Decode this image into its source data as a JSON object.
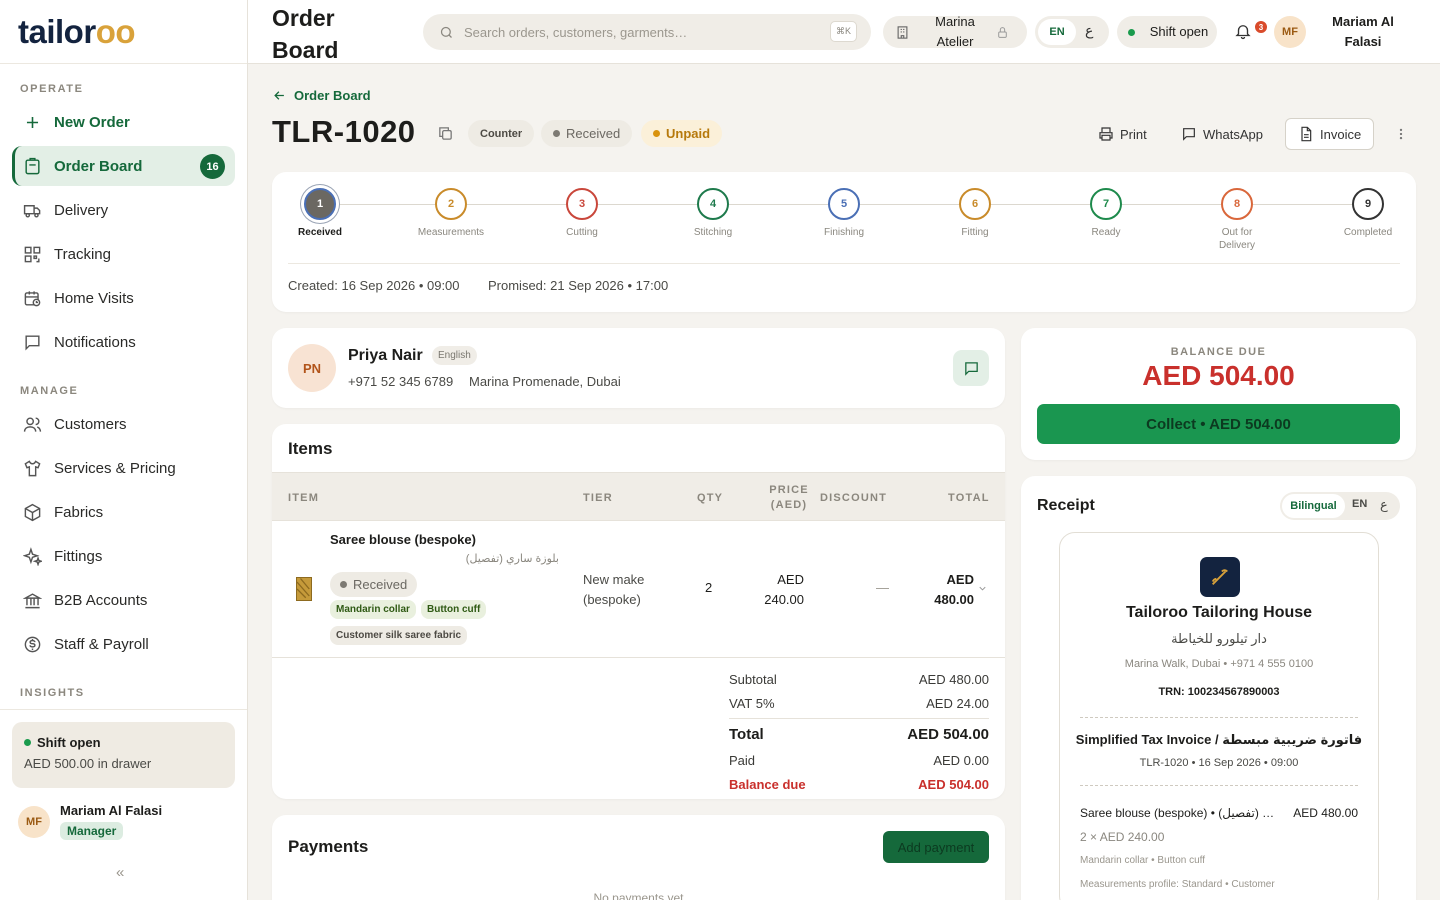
{
  "brand": {
    "logo_main": "tailor",
    "logo_accent": "oo"
  },
  "sidebar": {
    "section_operate": "OPERATE",
    "section_manage": "MANAGE",
    "section_insights": "INSIGHTS",
    "new_order": "New Order",
    "items": [
      {
        "label": "Order Board",
        "badge": "16"
      },
      {
        "label": "Delivery"
      },
      {
        "label": "Tracking"
      },
      {
        "label": "Home Visits"
      },
      {
        "label": "Notifications"
      },
      {
        "label": "Customers"
      },
      {
        "label": "Services & Pricing"
      },
      {
        "label": "Fabrics"
      },
      {
        "label": "Fittings"
      },
      {
        "label": "B2B Accounts"
      },
      {
        "label": "Staff & Payroll"
      }
    ],
    "shift": {
      "title": "Shift open",
      "drawer": "AED 500.00 in drawer"
    },
    "user": {
      "initials": "MF",
      "name": "Mariam Al Falasi",
      "role": "Manager"
    },
    "collapse": "«"
  },
  "topbar": {
    "title": "Order Board",
    "search_placeholder": "Search orders, customers, garments…",
    "shortcut": "⌘K",
    "branch": "Marina Atelier",
    "lang_en": "EN",
    "lang_ar": "ع",
    "shift": "Shift open",
    "notif_count": "3",
    "user_initials": "MF",
    "user_name": "Mariam Al Falasi"
  },
  "order": {
    "back": "Order Board",
    "id": "TLR-1020",
    "channel": "Counter",
    "status": "Received",
    "payment": "Unpaid",
    "actions": {
      "print": "Print",
      "whatsapp": "WhatsApp",
      "invoice": "Invoice"
    },
    "steps": [
      {
        "n": "1",
        "label": "Received",
        "color": "#4a6fb5"
      },
      {
        "n": "2",
        "label": "Measurements",
        "color": "#c98b2a"
      },
      {
        "n": "3",
        "label": "Cutting",
        "color": "#c9473b"
      },
      {
        "n": "4",
        "label": "Stitching",
        "color": "#1e7a4c"
      },
      {
        "n": "5",
        "label": "Finishing",
        "color": "#4a6fb5"
      },
      {
        "n": "6",
        "label": "Fitting",
        "color": "#c98b2a"
      },
      {
        "n": "7",
        "label": "Ready",
        "color": "#1e8a4c"
      },
      {
        "n": "8",
        "label": "Out for Delivery",
        "color": "#d9673b"
      },
      {
        "n": "9",
        "label": "Completed",
        "color": "#333333"
      }
    ],
    "created": "Created: 16 Sep 2026 • 09:00",
    "promised": "Promised: 21 Sep 2026 • 17:00"
  },
  "customer": {
    "initials": "PN",
    "name": "Priya Nair",
    "language": "English",
    "phone": "+971 52 345 6789",
    "address": "Marina Promenade, Dubai"
  },
  "items": {
    "title": "Items",
    "headers": {
      "item": "ITEM",
      "tier": "TIER",
      "qty": "QTY",
      "price": "PRICE (AED)",
      "discount": "DISCOUNT",
      "total": "TOTAL"
    },
    "row": {
      "name": "Saree blouse (bespoke)",
      "name_ar": "بلوزة ساري (تفصيل)",
      "status": "Received",
      "chips": [
        "Mandarin collar",
        "Button cuff",
        "Customer silk saree fabric"
      ],
      "tier": "New make (bespoke)",
      "qty": "2",
      "price": "AED 240.00",
      "discount": "—",
      "total": "AED 480.00"
    },
    "totals": {
      "subtotal_label": "Subtotal",
      "subtotal": "AED 480.00",
      "vat_label": "VAT 5%",
      "vat": "AED 24.00",
      "total_label": "Total",
      "total": "AED 504.00",
      "paid_label": "Paid",
      "paid": "AED 0.00",
      "balance_label": "Balance due",
      "balance": "AED 504.00"
    }
  },
  "payments": {
    "title": "Payments",
    "add": "Add payment",
    "empty": "No payments yet"
  },
  "balance": {
    "label": "BALANCE DUE",
    "amount": "AED 504.00",
    "collect": "Collect • AED 504.00"
  },
  "receipt": {
    "title": "Receipt",
    "modes": [
      "Bilingual",
      "EN",
      "ع"
    ],
    "shop": "Tailoroo Tailoring House",
    "shop_ar": "دار تيلورو للخياطة",
    "address": "Marina Walk, Dubai • +971 4 555 0100",
    "trn": "TRN: 100234567890003",
    "doc_title": "Simplified Tax Invoice / فاتورة ضريبية مبسطة",
    "doc_ref": "TLR-1020 • 16 Sep 2026 • 09:00",
    "line_name": "Saree blouse (bespoke) • (تفصيل) …",
    "line_amount": "AED 480.00",
    "line_qty": "2 × AED 240.00",
    "line_options": "Mandarin collar • Button cuff",
    "line_profile": "Measurements profile: Standard • Customer"
  },
  "colors": {
    "brand_green": "#15693b",
    "accent_gold": "#d9a23a",
    "danger": "#c9302c",
    "collect_green": "#1a9650"
  }
}
